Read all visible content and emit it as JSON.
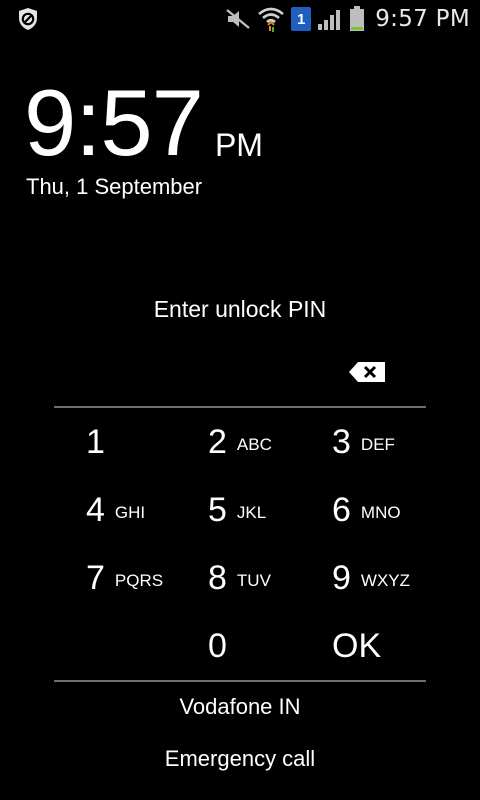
{
  "status_bar": {
    "time": "9:57 PM",
    "sim_badge": "1",
    "icons": [
      "security-shield-icon",
      "mute-icon",
      "wifi-icon",
      "sim-icon",
      "signal-icon",
      "battery-icon"
    ]
  },
  "clock": {
    "time": "9:57",
    "ampm": "PM",
    "date": "Thu, 1 September"
  },
  "unlock": {
    "prompt": "Enter unlock PIN",
    "backspace_icon": "backspace-icon"
  },
  "keypad": {
    "keys": [
      {
        "num": "1",
        "letters": ""
      },
      {
        "num": "2",
        "letters": "ABC"
      },
      {
        "num": "3",
        "letters": "DEF"
      },
      {
        "num": "4",
        "letters": "GHI"
      },
      {
        "num": "5",
        "letters": "JKL"
      },
      {
        "num": "6",
        "letters": "MNO"
      },
      {
        "num": "7",
        "letters": "PQRS"
      },
      {
        "num": "8",
        "letters": "TUV"
      },
      {
        "num": "9",
        "letters": "WXYZ"
      },
      {
        "num": "",
        "letters": ""
      },
      {
        "num": "0",
        "letters": ""
      },
      {
        "num": "OK",
        "letters": ""
      }
    ]
  },
  "footer": {
    "carrier": "Vodafone IN",
    "emergency": "Emergency call"
  },
  "colors": {
    "background": "#000000",
    "divider": "#6e6e6e",
    "sim_badge": "#1f5fbf",
    "battery_level": "#7cc142"
  }
}
